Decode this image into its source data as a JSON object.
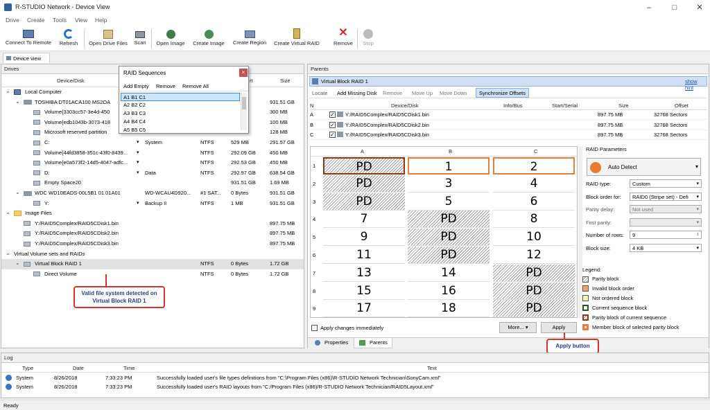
{
  "window": {
    "title": "R-STUDIO Network - Device View"
  },
  "menu": [
    "Drive",
    "Create",
    "Tools",
    "View",
    "Help"
  ],
  "toolbar": {
    "connect": "Connect To Remote",
    "refresh": "Refresh",
    "open_drive_files": "Open Drive Files",
    "scan": "Scan",
    "open_image": "Open Image",
    "create_image": "Create Image",
    "create_region": "Create Region",
    "create_virtual_raid": "Create Virtual RAID",
    "remove": "Remove",
    "stop": "Stop"
  },
  "tabs": {
    "device_view": "Device view"
  },
  "drives": {
    "header": "Drives",
    "columns": {
      "device": "Device/Disk",
      "start": "rt",
      "size": "Size"
    },
    "rows": [
      {
        "name": "Local Computer",
        "label": "",
        "fs": "",
        "start": "",
        "size": ""
      },
      {
        "name": "TOSHIBA DT01ACA100 MS2OA",
        "label": "",
        "fs": "",
        "start": "",
        "size": "931.51 GB"
      },
      {
        "name": "Volume{3303cc57-3e4d-450",
        "label": "",
        "fs": "",
        "start": "",
        "size": "300 MB"
      },
      {
        "name": "Volume{edb1043b-3073-418",
        "label": "",
        "fs": "",
        "start": "",
        "size": "100 MB"
      },
      {
        "name": "Microsoft reserved partition",
        "label": "",
        "fs": "",
        "start": "",
        "size": "128 MB"
      },
      {
        "name": "C:",
        "label": "System",
        "fs": "NTFS",
        "start": "529 MB",
        "size": "291.57 GB"
      },
      {
        "name": "Volume{44fd3858-351c-43f0-8439...",
        "label": "",
        "fs": "NTFS",
        "start": "292.09 GB",
        "size": "450 MB"
      },
      {
        "name": "Volume{e0a573f2-14d5-4047-adfc...",
        "label": "",
        "fs": "NTFS",
        "start": "292.53 GB",
        "size": "450 MB"
      },
      {
        "name": "D:",
        "label": "Data",
        "fs": "NTFS",
        "start": "292.97 GB",
        "size": "638.54 GB"
      },
      {
        "name": "Empty Space20",
        "label": "",
        "fs": "",
        "start": "931.51 GB",
        "size": "1.69 MB"
      },
      {
        "name": "WDC WD10EADS-00L5B1 01.01A01",
        "label": "WD-WCAU4D920...",
        "fs": "#1 SAT...",
        "start": "0 Bytes",
        "size": "931.51 GB"
      },
      {
        "name": "Y:",
        "label": "Backup II",
        "fs": "NTFS",
        "start": "1 MB",
        "size": "931.51 GB"
      },
      {
        "name": "Image Files",
        "label": "",
        "fs": "",
        "start": "",
        "size": ""
      },
      {
        "name": "Y:/RAID5Complex/RAID5CDisk1.bin",
        "label": "",
        "fs": "",
        "start": "",
        "size": "897.75 MB"
      },
      {
        "name": "Y:/RAID5Complex/RAID5CDisk2.bin",
        "label": "",
        "fs": "",
        "start": "",
        "size": "897.75 MB"
      },
      {
        "name": "Y:/RAID5Complex/RAID5CDisk3.bin",
        "label": "",
        "fs": "",
        "start": "",
        "size": "897.75 MB"
      },
      {
        "name": "Virtual Volume sets and RAIDs",
        "label": "",
        "fs": "",
        "start": "",
        "size": ""
      },
      {
        "name": "Virtual Block RAID 1",
        "label": "",
        "fs": "NTFS",
        "start": "0 Bytes",
        "size": "1.72 GB"
      },
      {
        "name": "Direct Volume",
        "label": "",
        "fs": "NTFS",
        "start": "0 Bytes",
        "size": "1.72 GB"
      }
    ]
  },
  "raid_seq": {
    "title": "RAID Sequences",
    "add_empty": "Add Empty",
    "remove": "Remove",
    "remove_all": "Remove All",
    "items": [
      "A1 B1 C1",
      "A2 B2 C2",
      "A3 B3 C3",
      "A4 B4 C4",
      "A5 B5 C5"
    ]
  },
  "callouts": {
    "valid": "Valid file system detected on Virtual Block RAID 1",
    "apply": "Apply button"
  },
  "parents": {
    "header": "Parents",
    "raid_name": "Virtual Block RAID 1",
    "show_hint": "show hint",
    "buttons": {
      "locate": "Locate",
      "add_missing": "Add Missing Disk",
      "remove": "Remove",
      "move_up": "Move Up",
      "move_down": "Move Down",
      "sync": "Synchronize Offsets"
    },
    "columns": {
      "n": "N",
      "device": "Device/Disk",
      "info": "Info/Bus",
      "start": "Start/Serial",
      "size": "Size",
      "offset": "Offset"
    },
    "disks": [
      {
        "n": "A",
        "path": "Y:/RAID5Complex/RAID5CDisk1.bin",
        "size": "897.75 MB",
        "offset": "32768 Sectors"
      },
      {
        "n": "B",
        "path": "Y:/RAID5Complex/RAID5CDisk2.bin",
        "size": "897.75 MB",
        "offset": "32768 Sectors"
      },
      {
        "n": "C",
        "path": "Y:/RAID5Complex/RAID5CDisk3.bin",
        "size": "897.75 MB",
        "offset": "32768 Sectors"
      }
    ],
    "grid": {
      "cols": [
        "A",
        "B",
        "C"
      ],
      "rows": [
        {
          "n": "1",
          "cells": [
            "PD",
            "1",
            "2"
          ]
        },
        {
          "n": "2",
          "cells": [
            "PD",
            "3",
            "4"
          ]
        },
        {
          "n": "3",
          "cells": [
            "PD",
            "5",
            "6"
          ]
        },
        {
          "n": "4",
          "cells": [
            "7",
            "PD",
            "8"
          ]
        },
        {
          "n": "5",
          "cells": [
            "9",
            "PD",
            "10"
          ]
        },
        {
          "n": "6",
          "cells": [
            "11",
            "PD",
            "12"
          ]
        },
        {
          "n": "7",
          "cells": [
            "13",
            "14",
            "PD"
          ]
        },
        {
          "n": "8",
          "cells": [
            "15",
            "16",
            "PD"
          ]
        },
        {
          "n": "9",
          "cells": [
            "17",
            "18",
            "PD"
          ]
        }
      ]
    },
    "apply_immediately": "Apply changes immediately",
    "more": "More...",
    "apply": "Apply"
  },
  "raid_params": {
    "title": "RAID Parameters",
    "auto_detect": "Auto Detect",
    "fields": [
      {
        "label": "RAID type:",
        "value": "Custom"
      },
      {
        "label": "Block order for:",
        "value": "RAID0 (Stripe set) - Defi"
      },
      {
        "label": "Parity delay:",
        "value": "Not used"
      },
      {
        "label": "First parity:",
        "value": ""
      },
      {
        "label": "Number of rows:",
        "value": "9"
      },
      {
        "label": "Block size:",
        "value": "4 KB"
      }
    ],
    "legend_title": "Legend:",
    "legend": [
      "Parity block",
      "Invalid block order",
      "Not ordered block",
      "Current sequence block",
      "Parity block of current sequence",
      "Member block of selected parity block"
    ]
  },
  "bottom_tabs": {
    "properties": "Properties",
    "parents": "Parents"
  },
  "log": {
    "header": "Log",
    "columns": {
      "type": "Type",
      "date": "Date",
      "time": "Time",
      "text": "Text"
    },
    "rows": [
      {
        "type": "System",
        "date": "8/26/2018",
        "time": "7:33:23 PM",
        "text": "Successfully loaded user's file types definitions from \"C:\\Program Files (x86)\\R-STUDIO Network Technician\\SonyCam.xml\""
      },
      {
        "type": "System",
        "date": "8/26/2018",
        "time": "7:33:23 PM",
        "text": "Successfully loaded user's RAID layouts from \"C:/Program Files (x86)/R-STUDIO Network Technician/RAID5Layout.xml\""
      }
    ]
  },
  "status": "Ready"
}
